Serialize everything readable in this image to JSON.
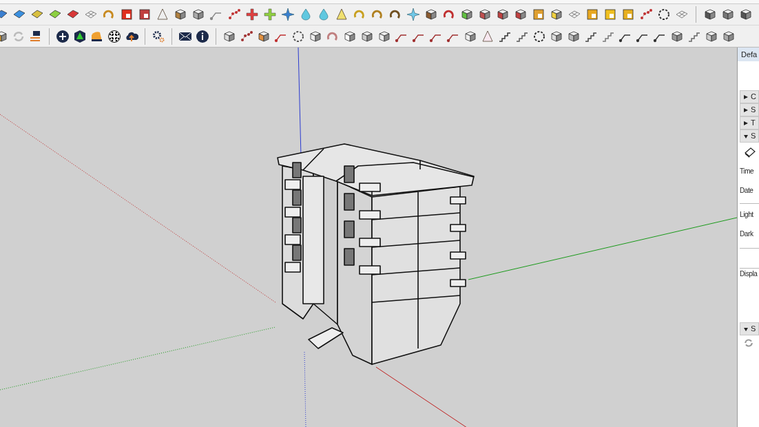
{
  "tray": {
    "title": "Defa",
    "sections": [
      {
        "label": "C",
        "expanded": false
      },
      {
        "label": "S",
        "expanded": false
      },
      {
        "label": "T",
        "expanded": false
      },
      {
        "label": "S",
        "expanded": true,
        "kind": "shadows",
        "fields": [
          "Time",
          "Date",
          "Light",
          "Dark",
          "Displa"
        ]
      },
      {
        "label": "S",
        "expanded": true,
        "kind": "refresh"
      }
    ]
  }
}
